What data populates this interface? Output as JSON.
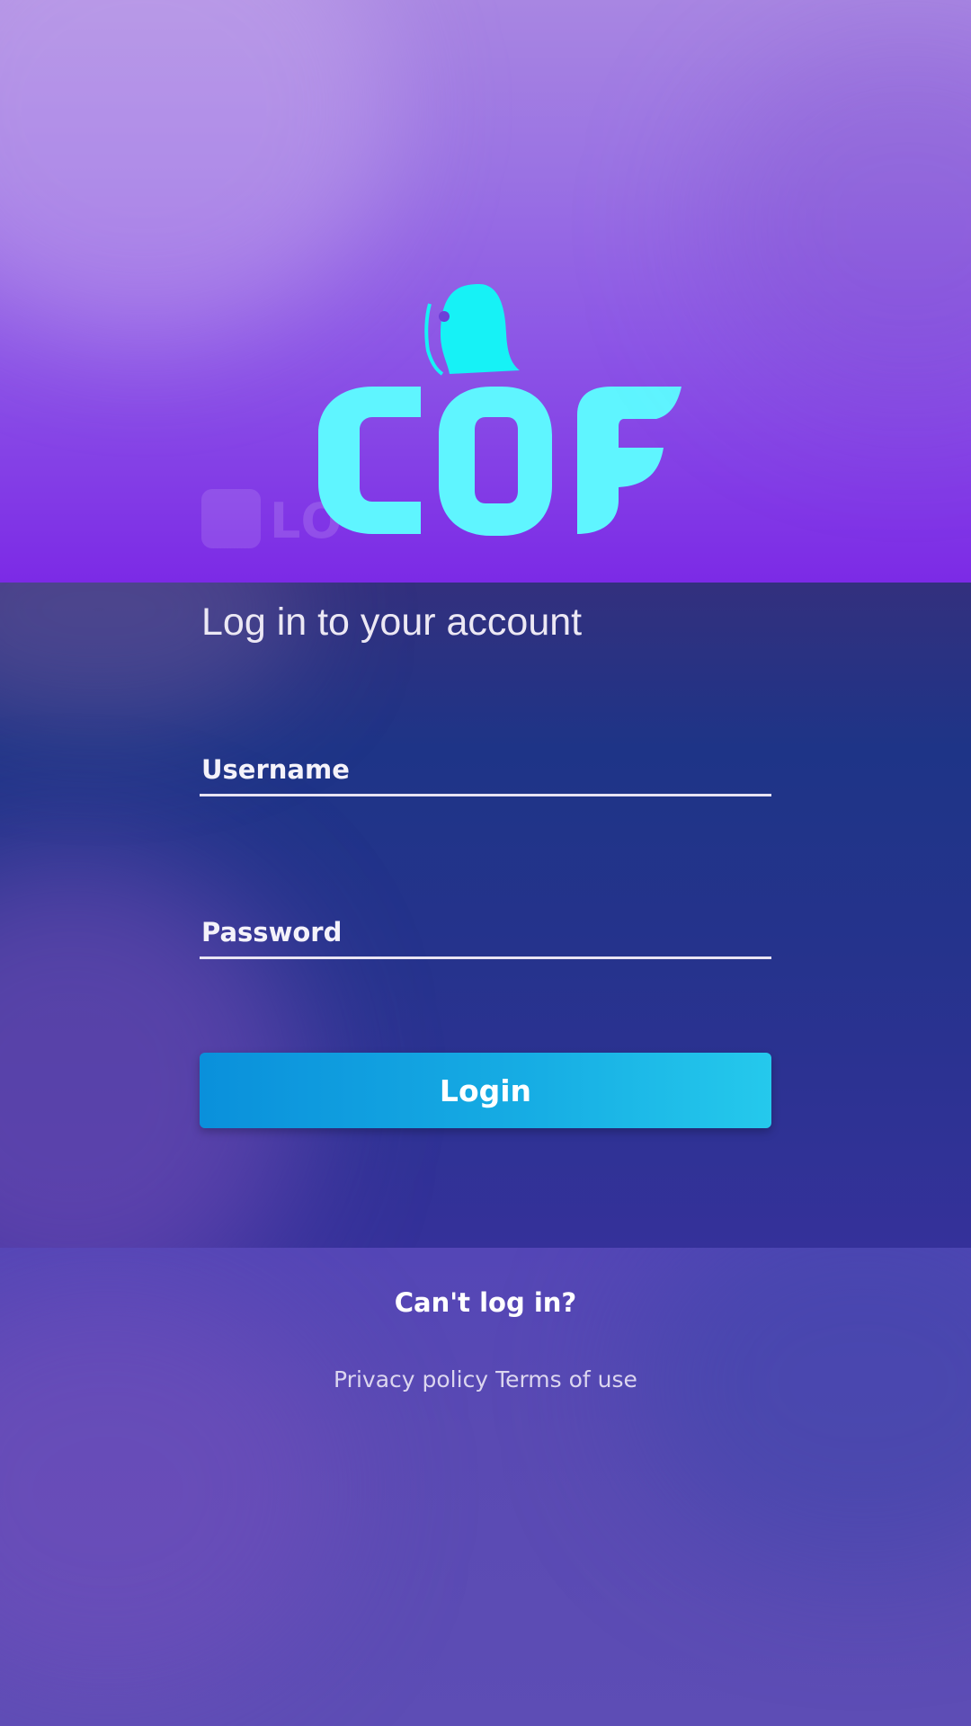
{
  "brand": {
    "logo_text": "COF"
  },
  "login": {
    "heading": "Log in to your account",
    "username_placeholder": "Username",
    "password_placeholder": "Password",
    "login_label": "Login"
  },
  "footer": {
    "cant_login": "Can't log in?",
    "privacy_policy": "Privacy policy",
    "terms_of_use": "Terms of use"
  },
  "colors": {
    "accent_cyan": "#5ff5ff",
    "button_start": "#0a90db",
    "button_end": "#25c9ec"
  }
}
